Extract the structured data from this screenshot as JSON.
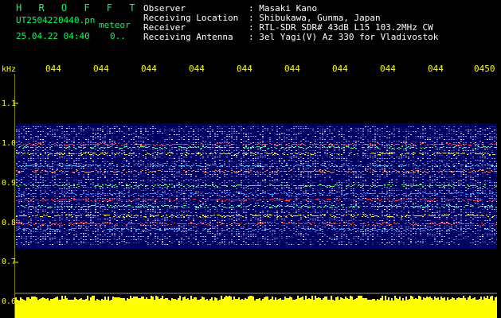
{
  "app": {
    "title": "H R O F F T",
    "filename": "UT2504220440.pn",
    "meteor_label": "meteor",
    "timestamp": "25.04.22 04:40",
    "subvalue": "0.."
  },
  "header": {
    "rows": [
      {
        "label": "Observer",
        "value": ": Masaki Kano"
      },
      {
        "label": "Receiving Location",
        "value": ": Shibukawa, Gunma, Japan"
      },
      {
        "label": "Receiver",
        "value": ": RTL-SDR SDR# 43dB L15 103.2MHz CW"
      },
      {
        "label": "Receiving Antenna",
        "value": ": 3el Yagi(V) Az 330 for Vladivostok"
      }
    ]
  },
  "axis": {
    "unit": "kHz",
    "y_ticks": [
      "1.1",
      "1.0",
      "0.9",
      "0.8",
      "0.7",
      "0.6"
    ],
    "x_ticks": [
      "044",
      "044",
      "044",
      "044",
      "044",
      "044",
      "044",
      "044",
      "044",
      "0450"
    ]
  },
  "colors": {
    "text_green": "#00ff66",
    "text_white": "#ffffff",
    "axis_yellow": "#ffff00",
    "background": "#000000",
    "spectrum_bg": "#000080"
  }
}
